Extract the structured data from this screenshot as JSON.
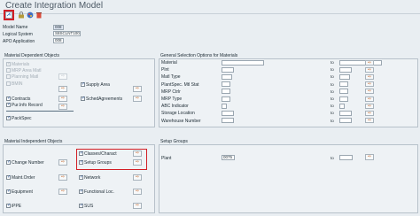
{
  "window": {
    "title": "Create Integration Model"
  },
  "toolbar": {
    "execute_icon": "execute-icon",
    "icon2": "lock-icon",
    "icon3": "palette-icon",
    "icon4": "delete-icon"
  },
  "header_fields": {
    "model_name_label": "Model Name",
    "model_name_value": "008",
    "logical_system_label": "Logical System",
    "logical_system_value": "S8SCLNT100",
    "apo_application_label": "APO Application",
    "apo_application_value": "008"
  },
  "mdo": {
    "title": "Material Dependent Objects",
    "materials": "Materials",
    "mrp_area_matl": "MRP Area Matl",
    "planning_matl": "Planning Matl",
    "bmin": "BMIN",
    "supply_area": "Supply Area",
    "contracts": "Contracts",
    "sched_agreements": "SchedAgreements",
    "pur_info_record": "Pur.Info Record",
    "packspec": "PackSpec"
  },
  "gso": {
    "title": "General Selection Options for Materials",
    "to_label": "to",
    "rows": [
      "Material",
      "Plnt",
      "Matl Type",
      "PlantSpec. Mtl Stat",
      "MRP Ctrlr",
      "MRP Type",
      "ABC Indicator",
      "Storage Location",
      "Warehouse Number"
    ]
  },
  "mio": {
    "title": "Material Independent Objects",
    "change_number": "Change Number",
    "classes_charact": "Classes/Charact",
    "setup_groups": "Setup Groups",
    "maint_order": "Maint.Order",
    "network": "Network",
    "equipment": "Equipment",
    "functional_loc": "Functional Loc.",
    "ippe": "iPPE",
    "sus": "SUS"
  },
  "setup_groups": {
    "title": "Setup Groups",
    "plant_label": "Plant",
    "plant_value": "0075",
    "to_label": "to"
  }
}
